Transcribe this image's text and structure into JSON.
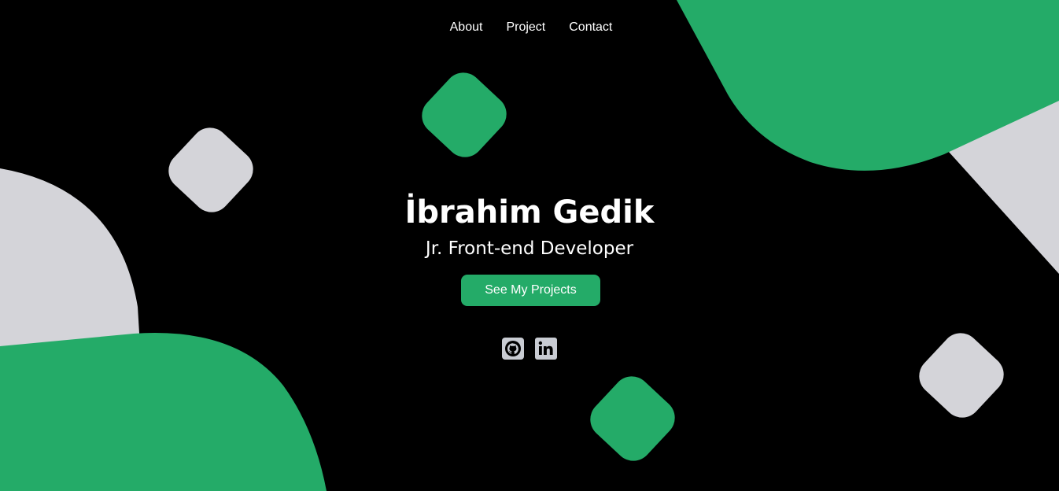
{
  "colors": {
    "background": "#000000",
    "accent_green": "#24ab68",
    "shape_gray": "#d4d4d9",
    "icon_gray": "#c9ccd3",
    "text": "#ffffff"
  },
  "nav": {
    "items": [
      {
        "label": "About"
      },
      {
        "label": "Project"
      },
      {
        "label": "Contact"
      }
    ]
  },
  "hero": {
    "name": "İbrahim Gedik",
    "title": "Jr. Front-end Developer",
    "cta_label": "See My Projects"
  },
  "socials": {
    "github_icon": "github-icon",
    "linkedin_icon": "linkedin-icon"
  }
}
